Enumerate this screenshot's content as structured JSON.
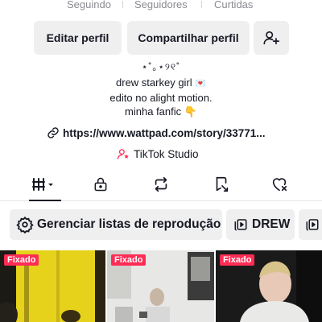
{
  "stats": {
    "following_label": "Seguindo",
    "followers_label": "Seguidores",
    "likes_label": "Curtidas"
  },
  "actions": {
    "edit_label": "Editar perfil",
    "share_label": "Compartilhar perfil",
    "add_friend_icon": "add-user-icon"
  },
  "bio": {
    "decoration": "⋆˚｡⋆୨୧˚",
    "line1": "drew starkey girl",
    "line1_emoji": "💌",
    "line2": "edito no alight motion.",
    "line3": "minha fanfic",
    "line3_emoji": "👇"
  },
  "link": {
    "icon": "link-icon",
    "url": "https://www.wattpad.com/story/33771..."
  },
  "studio": {
    "icon": "tiktok-studio-icon",
    "label": "TikTok Studio"
  },
  "tabs": [
    {
      "name": "videos",
      "icon": "grid-icon"
    },
    {
      "name": "private",
      "icon": "lock-icon"
    },
    {
      "name": "reposts",
      "icon": "repost-icon"
    },
    {
      "name": "saved",
      "icon": "bookmark-icon"
    },
    {
      "name": "liked",
      "icon": "heart-icon"
    }
  ],
  "playlists": {
    "manage_label": "Gerenciar listas de reprodução",
    "drew_label": "DREW"
  },
  "videos": [
    {
      "badge": "Fixado"
    },
    {
      "badge": "Fixado"
    },
    {
      "badge": "Fixado"
    }
  ],
  "colors": {
    "accent": "#fe2c55",
    "button_bg": "#efeff0",
    "text": "#161823",
    "muted": "#8a8b91"
  }
}
